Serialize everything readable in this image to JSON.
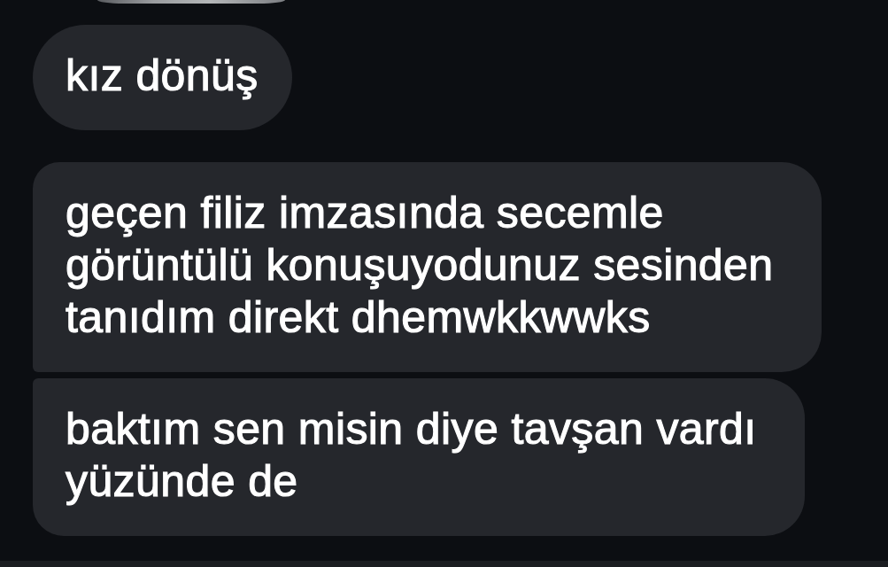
{
  "groups": [
    {
      "items": [
        {
          "kind": "photo"
        }
      ]
    },
    {
      "items": [
        {
          "kind": "text",
          "text": "kız dönüş"
        }
      ]
    },
    {
      "items": [
        {
          "kind": "text",
          "text": "geçen filiz imzasında secemle\ngörüntülü konuşuyodunuz sesinden\ntanıdım direkt dhemwkkwwks"
        },
        {
          "kind": "text",
          "text": "baktım sen misin diye tavşan vardı\nyüzünde de"
        }
      ]
    }
  ]
}
